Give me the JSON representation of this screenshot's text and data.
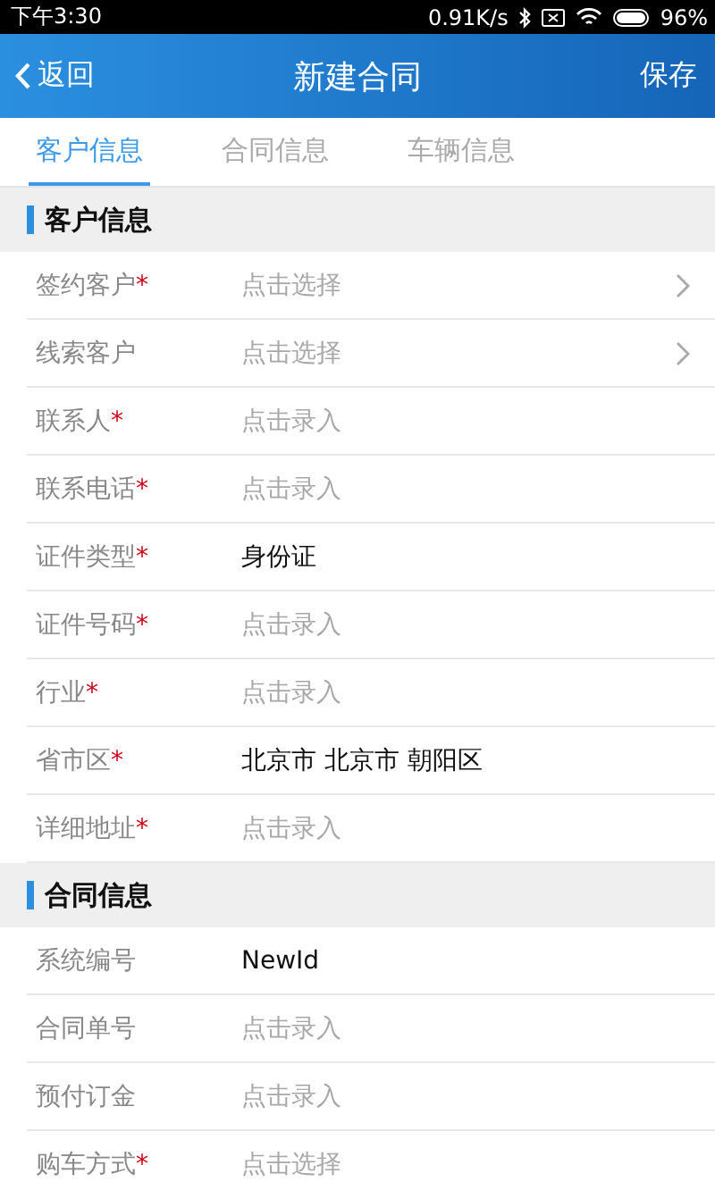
{
  "status_bar": {
    "time": "下午3:30",
    "speed": "0.91K/s",
    "battery": "96%"
  },
  "header": {
    "back": "返回",
    "title": "新建合同",
    "action": "保存"
  },
  "tabs": [
    {
      "label": "客户信息",
      "selected": true
    },
    {
      "label": "合同信息",
      "selected": false
    },
    {
      "label": "车辆信息",
      "selected": false
    }
  ],
  "sections": [
    {
      "title": "客户信息",
      "fields": [
        {
          "label": "签约客户",
          "asterisk": "*",
          "placeholder": "点击选择",
          "arrow": true
        },
        {
          "label": "线索客户",
          "placeholder": "点击选择",
          "arrow": true
        },
        {
          "label": "联系人",
          "asterisk": "*",
          "placeholder": "点击录入"
        },
        {
          "label": "联系电话",
          "asterisk": "*",
          "placeholder": "点击录入"
        },
        {
          "label": "证件类型",
          "asterisk": "*",
          "value": "身份证"
        },
        {
          "label": "证件号码",
          "asterisk": "*",
          "placeholder": "点击录入"
        },
        {
          "label": "行业",
          "asterisk": "*",
          "placeholder": "点击录入"
        },
        {
          "label": "省市区",
          "asterisk": "*",
          "value": "北京市 北京市 朝阳区"
        },
        {
          "label": "详细地址",
          "asterisk": "*",
          "placeholder": "点击录入"
        }
      ]
    },
    {
      "title": "合同信息",
      "fields": [
        {
          "label": "系统编号",
          "value": "NewId"
        },
        {
          "label": "合同单号",
          "placeholder": "点击录入"
        },
        {
          "label": "预付订金",
          "placeholder": "点击录入"
        },
        {
          "label": "购车方式",
          "asterisk": "*",
          "placeholder": "点击选择"
        }
      ]
    }
  ]
}
